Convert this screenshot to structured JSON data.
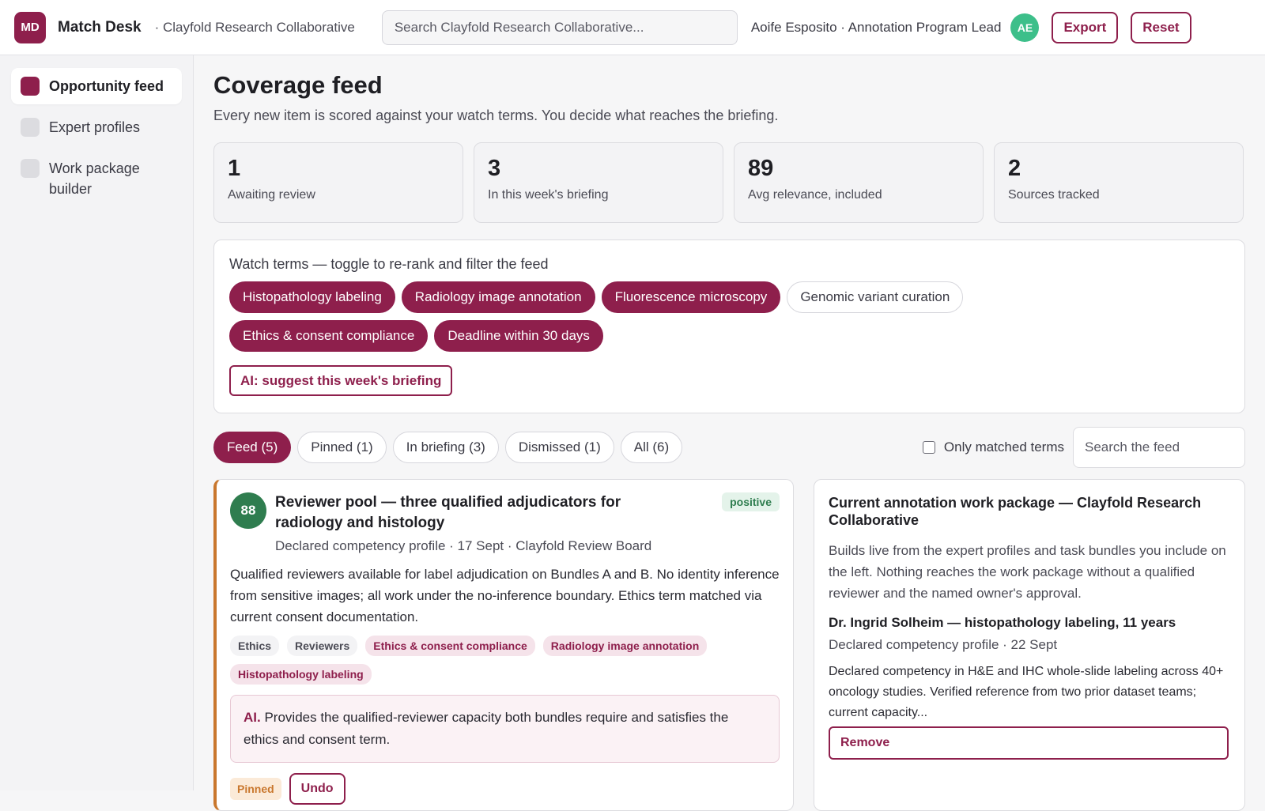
{
  "header": {
    "logo": "MD",
    "app_name": "Match Desk",
    "org": "· Clayfold Research Collaborative",
    "search_placeholder": "Search Clayfold Research Collaborative...",
    "user": "Aoife Esposito · Annotation Program Lead",
    "avatar": "AE",
    "export_label": "Export",
    "reset_label": "Reset"
  },
  "sidebar": {
    "items": [
      {
        "label": "Opportunity feed",
        "active": true
      },
      {
        "label": "Expert profiles",
        "active": false
      },
      {
        "label": "Work package builder",
        "active": false
      }
    ]
  },
  "main": {
    "title": "Coverage feed",
    "subtitle": "Every new item is scored against your watch terms. You decide what reaches the briefing.",
    "stats": [
      {
        "value": "1",
        "label": "Awaiting review"
      },
      {
        "value": "3",
        "label": "In this week's briefing"
      },
      {
        "value": "89",
        "label": "Avg relevance, included"
      },
      {
        "value": "2",
        "label": "Sources tracked"
      }
    ],
    "watch": {
      "title": "Watch terms — toggle to re-rank and filter the feed",
      "terms": [
        {
          "label": "Histopathology labeling",
          "on": true
        },
        {
          "label": "Radiology image annotation",
          "on": true
        },
        {
          "label": "Fluorescence microscopy",
          "on": true
        },
        {
          "label": "Genomic variant curation",
          "on": false
        },
        {
          "label": "Ethics & consent compliance",
          "on": true
        },
        {
          "label": "Deadline within 30 days",
          "on": true
        }
      ],
      "ai_button": "AI: suggest this week's briefing"
    },
    "tabs": [
      {
        "label": "Feed (5)",
        "active": true
      },
      {
        "label": "Pinned (1)",
        "active": false
      },
      {
        "label": "In briefing (3)",
        "active": false
      },
      {
        "label": "Dismissed (1)",
        "active": false
      },
      {
        "label": "All (6)",
        "active": false
      }
    ],
    "only_matched_label": "Only matched terms",
    "feed_search_placeholder": "Search the feed"
  },
  "feed_item": {
    "score": "88",
    "title": "Reviewer pool — three qualified adjudicators for radiology and histology",
    "sentiment": "positive",
    "meta": "Declared competency profile · 17 Sept · Clayfold Review Board",
    "body": "Qualified reviewers available for label adjudication on Bundles A and B. No identity inference from sensitive images; all work under the no-inference boundary. Ethics term matched via current consent documentation.",
    "tags": [
      {
        "label": "Ethics",
        "highlight": false
      },
      {
        "label": "Reviewers",
        "highlight": false
      },
      {
        "label": "Ethics & consent compliance",
        "highlight": true
      },
      {
        "label": "Radiology image annotation",
        "highlight": true
      },
      {
        "label": "Histopathology labeling",
        "highlight": true
      }
    ],
    "ai_prefix": "AI.",
    "ai_text": "Provides the qualified-reviewer capacity both bundles require and satisfies the ethics and consent term.",
    "pinned_label": "Pinned",
    "undo_label": "Undo"
  },
  "work_package": {
    "title": "Current annotation work package — Clayfold Research Collaborative",
    "description": "Builds live from the expert profiles and task bundles you include on the left. Nothing reaches the work package without a qualified reviewer and the named owner's approval.",
    "expert_name": "Dr. Ingrid Solheim — histopathology labeling, 11 years",
    "expert_meta": "Declared competency profile · 22 Sept",
    "expert_body": "Declared competency in H&E and IHC whole-slide labeling across 40+ oncology studies. Verified reference from two prior dataset teams; current capacity...",
    "remove_label": "Remove"
  },
  "colors": {
    "brand": "#8e1f4c",
    "score_green": "#2f7d4f",
    "pinned_orange": "#c9772d",
    "avatar_green": "#3dbf8a"
  }
}
